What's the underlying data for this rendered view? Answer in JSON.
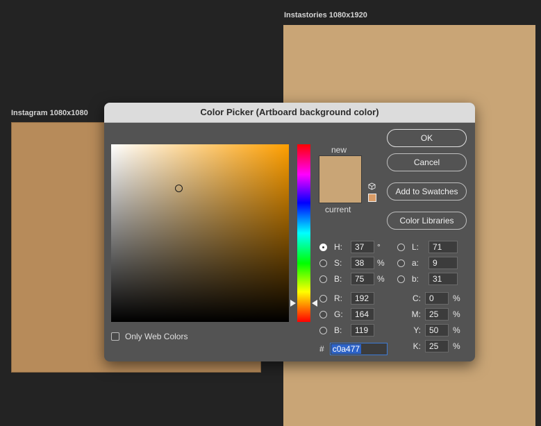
{
  "canvas": {
    "artboard1_label": "Instagram 1080x1080",
    "artboard2_label": "Instastories 1080x1920"
  },
  "dialog": {
    "title": "Color Picker (Artboard background color)",
    "new_label": "new",
    "current_label": "current",
    "only_web_colors_label": "Only Web Colors",
    "buttons": {
      "ok": "OK",
      "cancel": "Cancel",
      "add_to_swatches": "Add to Swatches",
      "color_libraries": "Color Libraries"
    },
    "hsb": [
      {
        "label": "H:",
        "value": "37",
        "unit": "°",
        "selected": true
      },
      {
        "label": "S:",
        "value": "38",
        "unit": "%",
        "selected": false
      },
      {
        "label": "B:",
        "value": "75",
        "unit": "%",
        "selected": false
      }
    ],
    "rgb": [
      {
        "label": "R:",
        "value": "192"
      },
      {
        "label": "G:",
        "value": "164"
      },
      {
        "label": "B:",
        "value": "119"
      }
    ],
    "lab": [
      {
        "label": "L:",
        "value": "71"
      },
      {
        "label": "a:",
        "value": "9"
      },
      {
        "label": "b:",
        "value": "31"
      }
    ],
    "cmyk": [
      {
        "label": "C:",
        "value": "0",
        "unit": "%"
      },
      {
        "label": "M:",
        "value": "25",
        "unit": "%"
      },
      {
        "label": "Y:",
        "value": "50",
        "unit": "%"
      },
      {
        "label": "K:",
        "value": "25",
        "unit": "%"
      }
    ],
    "hex_prefix": "#",
    "hex_value": "c0a477"
  },
  "colors": {
    "new_color": "#c9a576",
    "current_color": "#c9a576",
    "web_safe_swatch": "#d89b66",
    "artboard1_fill": "#b78b5a",
    "artboard2_fill": "#c9a576",
    "hue_base": "#ff9f00"
  },
  "icons": {
    "out_of_gamut": "cube-icon",
    "web_safe": "web-swatch-icon"
  }
}
